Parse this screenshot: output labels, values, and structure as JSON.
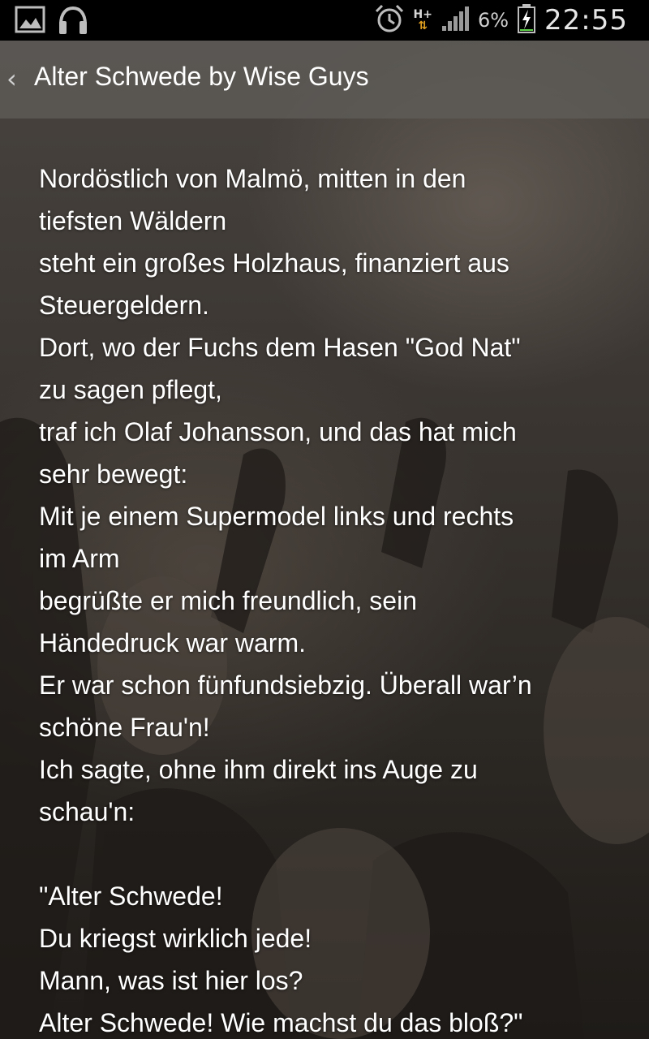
{
  "status_bar": {
    "icons_left": [
      "picture-icon",
      "headphones-icon"
    ],
    "alarm_icon": "alarm-icon",
    "network": "H+",
    "signal_icon": "signal-icon",
    "battery_percent": "6%",
    "battery_level": 0.06,
    "battery_icon": "battery-charging-icon",
    "time": "22:55"
  },
  "action_bar": {
    "back_glyph": "‹",
    "title": "Alter Schwede by Wise Guys"
  },
  "lyrics": {
    "lines": [
      "Nordöstlich von Malmö, mitten in den",
      "tiefsten Wäldern",
      "steht ein großes Holzhaus, finanziert aus",
      "Steuergeldern.",
      "Dort, wo der Fuchs dem Hasen \"God Nat\"",
      "zu sagen pflegt,",
      "traf ich Olaf Johansson, und das hat mich",
      "sehr bewegt:",
      "Mit je einem Supermodel links und rechts",
      "im Arm",
      "begrüßte er mich freundlich, sein",
      "Händedruck war warm.",
      "Er war schon fünfundsiebzig. Überall war’n",
      "schöne Frau'n!",
      "Ich sagte, ohne ihm direkt ins Auge zu",
      "schau'n:",
      "",
      "\"Alter Schwede!",
      "Du kriegst wirklich jede!",
      "Mann, was ist hier los?",
      "Alter Schwede! Wie machst du das bloß?\""
    ]
  }
}
